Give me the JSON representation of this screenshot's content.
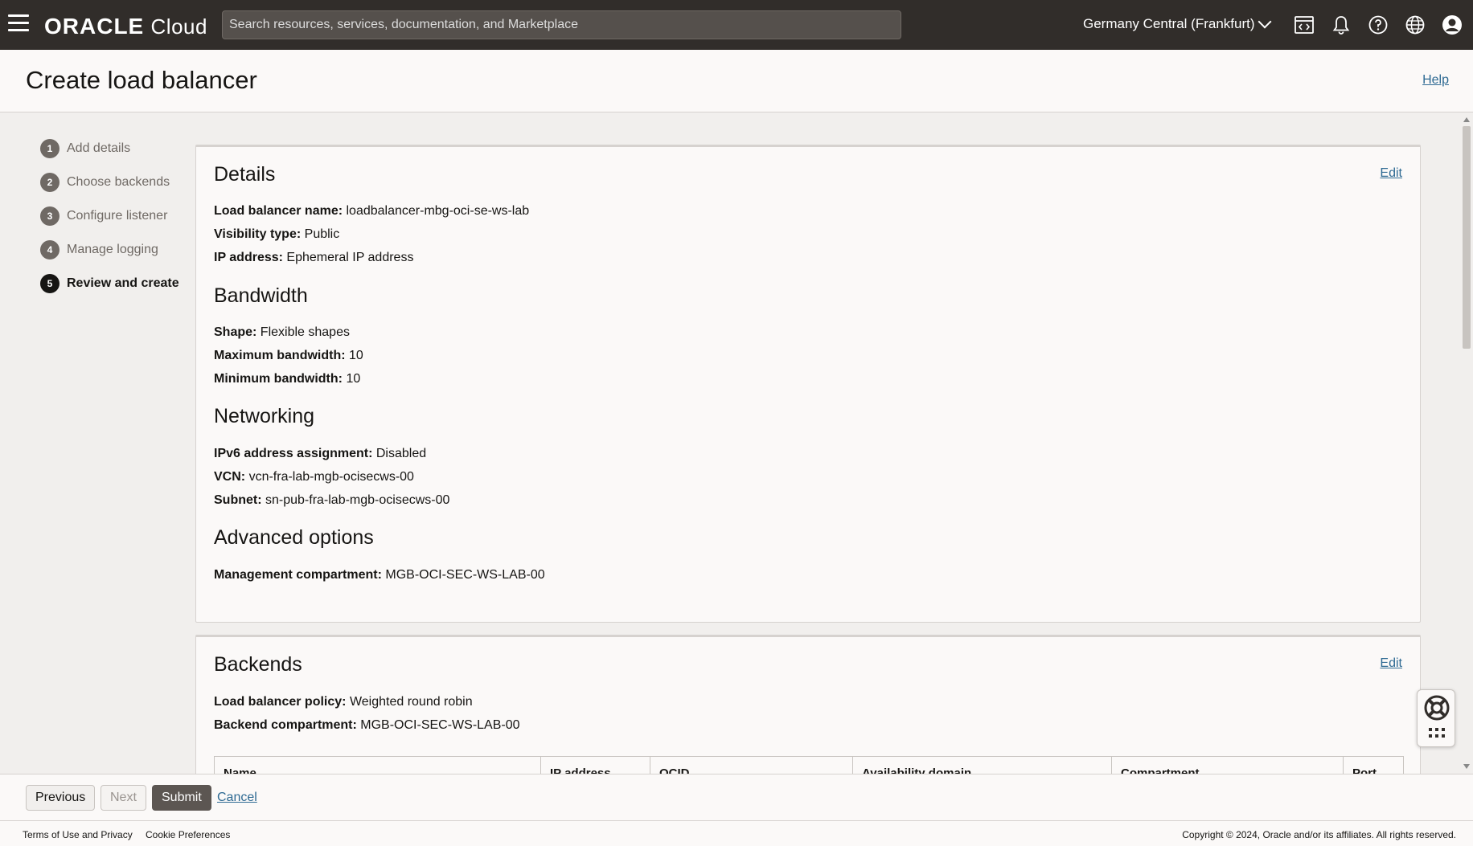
{
  "topbar": {
    "brand_main": "ORACLE",
    "brand_sub": "Cloud",
    "search_placeholder": "Search resources, services, documentation, and Marketplace",
    "region": "Germany Central (Frankfurt)"
  },
  "header": {
    "title": "Create load balancer",
    "help": "Help"
  },
  "steps": [
    {
      "num": "1",
      "label": "Add details"
    },
    {
      "num": "2",
      "label": "Choose backends"
    },
    {
      "num": "3",
      "label": "Configure listener"
    },
    {
      "num": "4",
      "label": "Manage logging"
    },
    {
      "num": "5",
      "label": "Review and create"
    }
  ],
  "details": {
    "title": "Details",
    "edit": "Edit",
    "rows": [
      {
        "k": "Load balancer name:",
        "v": "loadbalancer-mbg-oci-se-ws-lab"
      },
      {
        "k": "Visibility type:",
        "v": "Public"
      },
      {
        "k": "IP address:",
        "v": "Ephemeral IP address"
      }
    ],
    "bandwidth_title": "Bandwidth",
    "bandwidth_rows": [
      {
        "k": "Shape:",
        "v": "Flexible shapes"
      },
      {
        "k": "Maximum bandwidth:",
        "v": "10"
      },
      {
        "k": "Minimum bandwidth:",
        "v": "10"
      }
    ],
    "networking_title": "Networking",
    "networking_rows": [
      {
        "k": "IPv6 address assignment:",
        "v": "Disabled"
      },
      {
        "k": "VCN:",
        "v": "vcn-fra-lab-mgb-ocisecws-00"
      },
      {
        "k": "Subnet:",
        "v": "sn-pub-fra-lab-mgb-ocisecws-00"
      }
    ],
    "advanced_title": "Advanced options",
    "advanced_rows": [
      {
        "k": "Management compartment:",
        "v": "MGB-OCI-SEC-WS-LAB-00"
      }
    ]
  },
  "backends": {
    "title": "Backends",
    "edit": "Edit",
    "rows": [
      {
        "k": "Load balancer policy:",
        "v": "Weighted round robin"
      },
      {
        "k": "Backend compartment:",
        "v": "MGB-OCI-SEC-WS-LAB-00"
      }
    ],
    "columns": [
      "Name",
      "IP address",
      "OCID",
      "Availability domain",
      "Compartment",
      "Port"
    ]
  },
  "actions": {
    "previous": "Previous",
    "next": "Next",
    "submit": "Submit",
    "cancel": "Cancel"
  },
  "footer": {
    "terms": "Terms of Use and Privacy",
    "cookies": "Cookie Preferences",
    "copyright": "Copyright © 2024, Oracle and/or its affiliates. All rights reserved."
  }
}
